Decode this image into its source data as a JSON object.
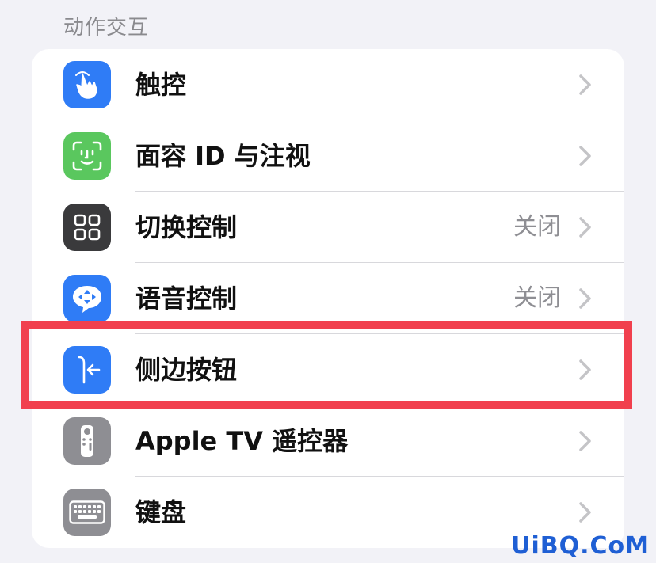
{
  "section": {
    "title": "动作交互"
  },
  "rows": [
    {
      "label": "触控",
      "value": "",
      "icon": "touch-hand-icon",
      "icon_bg": "#2f7cf6"
    },
    {
      "label": "面容 ID 与注视",
      "value": "",
      "icon": "face-id-icon",
      "icon_bg": "#5ac75e"
    },
    {
      "label": "切换控制",
      "value": "关闭",
      "icon": "switch-control-grid-icon",
      "icon_bg": "#3a3a3c"
    },
    {
      "label": "语音控制",
      "value": "关闭",
      "icon": "voice-control-icon",
      "icon_bg": "#2f7cf6"
    },
    {
      "label": "侧边按钮",
      "value": "",
      "icon": "side-button-icon",
      "icon_bg": "#2f7cf6"
    },
    {
      "label": "Apple TV 遥控器",
      "value": "",
      "icon": "apple-tv-remote-icon",
      "icon_bg": "#8e8e93"
    },
    {
      "label": "键盘",
      "value": "",
      "icon": "keyboard-icon",
      "icon_bg": "#8e8e93"
    }
  ],
  "highlight_color": "#f1404e",
  "watermark": "UiBQ.CoM"
}
